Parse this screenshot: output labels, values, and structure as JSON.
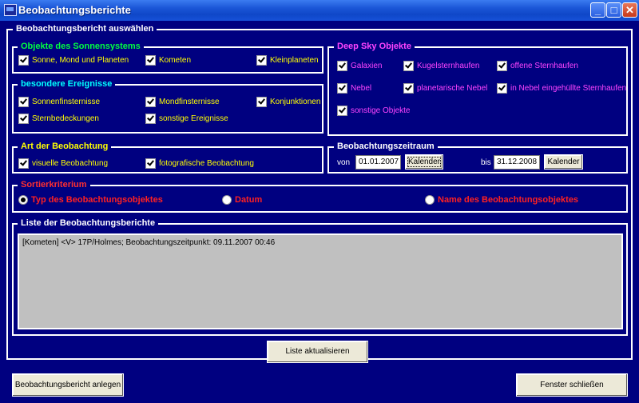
{
  "window": {
    "title": "Beobachtungsberichte",
    "controls": {
      "minimize": "_",
      "maximize": "□",
      "close": "✕"
    }
  },
  "outer_group": {
    "label": "Beobachtungsbericht auswählen"
  },
  "solar_system": {
    "label": "Objekte des Sonnensystems",
    "items": [
      {
        "label": "Sonne, Mond und Planeten",
        "checked": true
      },
      {
        "label": "Kometen",
        "checked": true
      },
      {
        "label": "Kleinplaneten",
        "checked": true
      }
    ]
  },
  "special_events": {
    "label": "besondere Ereignisse",
    "items": [
      {
        "label": "Sonnenfinsternisse",
        "checked": true
      },
      {
        "label": "Mondfinsternisse",
        "checked": true
      },
      {
        "label": "Konjunktionen",
        "checked": true
      },
      {
        "label": "Sternbedeckungen",
        "checked": true
      },
      {
        "label": "sonstige Ereignisse",
        "checked": true
      }
    ]
  },
  "deep_sky": {
    "label": "Deep Sky Objekte",
    "items": [
      {
        "label": "Galaxien",
        "checked": true
      },
      {
        "label": "Kugelsternhaufen",
        "checked": true
      },
      {
        "label": "offene Sternhaufen",
        "checked": true
      },
      {
        "label": "Nebel",
        "checked": true
      },
      {
        "label": "planetarische Nebel",
        "checked": true
      },
      {
        "label": "in Nebel eingehüllte Sternhaufen",
        "checked": true
      },
      {
        "label": "sonstige Objekte",
        "checked": true
      }
    ]
  },
  "observation_type": {
    "label": "Art der Beobachtung",
    "items": [
      {
        "label": "visuelle Beobachtung",
        "checked": true
      },
      {
        "label": "fotografische Beobachtung",
        "checked": true
      }
    ]
  },
  "period": {
    "label": "Beobachtungszeitraum",
    "from_label": "von",
    "from_value": "01.01.2007",
    "from_button": "Kalender",
    "to_label": "bis",
    "to_value": "31.12.2008",
    "to_button": "Kalender"
  },
  "sort": {
    "label": "Sortierkriterium",
    "options": [
      {
        "label": "Typ des Beobachtungsobjektes",
        "selected": true
      },
      {
        "label": "Datum",
        "selected": false
      },
      {
        "label": "Name des Beobachtungsobjektes",
        "selected": false
      }
    ]
  },
  "report_list": {
    "label": "Liste der Beobachtungsberichte",
    "items": [
      "[Kometen] <V> 17P/Holmes; Beobachtungszeitpunkt: 09.11.2007 00:46"
    ]
  },
  "buttons": {
    "refresh": "Liste aktualisieren",
    "create": "Beobachtungsbericht anlegen",
    "close": "Fenster schließen"
  },
  "colors": {
    "background": "#000080",
    "solar_label": "#00ff40",
    "special_label": "#00ffff",
    "deep_sky": "#ff44ff",
    "checkbox_text": "#ffff00",
    "sort_text": "#ff3030"
  }
}
